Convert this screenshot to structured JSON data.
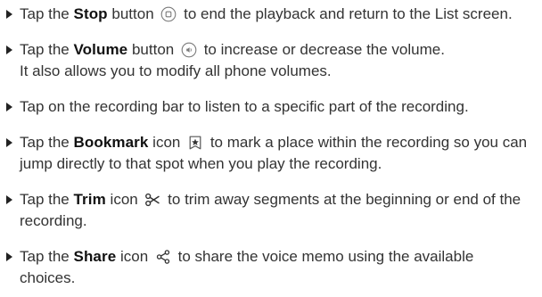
{
  "items": [
    {
      "pre": "Tap the ",
      "keyword": "Stop",
      "mid": " button ",
      "icon": "stop-button-icon",
      "post": " to end the playback and return to the List screen."
    },
    {
      "pre": "Tap the ",
      "keyword": "Volume",
      "mid": " button ",
      "icon": "volume-button-icon",
      "post": " to increase or decrease the volume.",
      "line2": "It also allows you to modify all phone volumes."
    },
    {
      "text": "Tap on the recording bar to listen to a specific part of the recording."
    },
    {
      "pre": "Tap the ",
      "keyword": "Bookmark",
      "mid": " icon ",
      "icon": "bookmark-icon",
      "post": " to mark a place within the recording so you can jump directly to that spot when you play the recording."
    },
    {
      "pre": "Tap the ",
      "keyword": "Trim",
      "mid": " icon ",
      "icon": "scissors-icon",
      "post": " to trim away segments at the beginning or end of the recording."
    },
    {
      "pre": "Tap the ",
      "keyword": "Share",
      "mid": " icon ",
      "icon": "share-icon",
      "post": " to share the voice memo using the available choices."
    }
  ]
}
